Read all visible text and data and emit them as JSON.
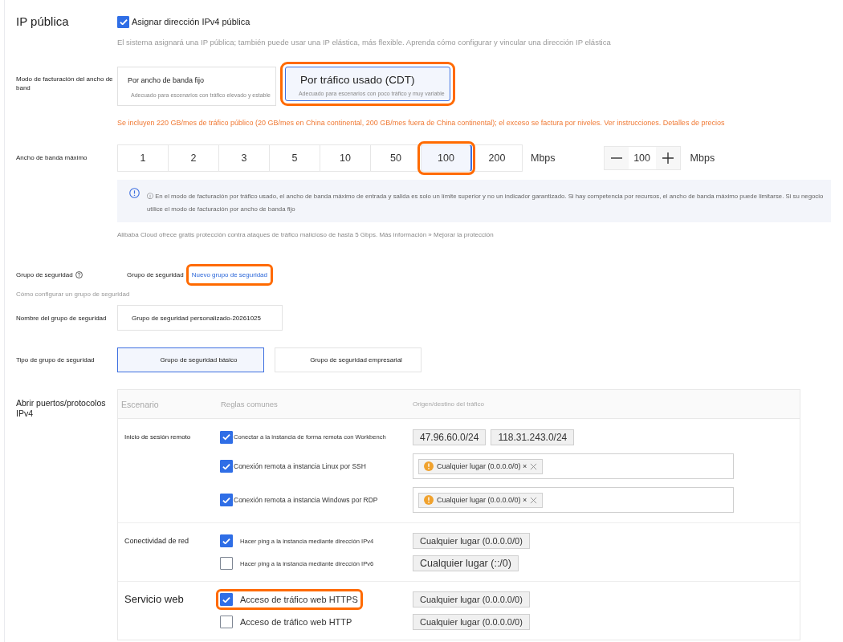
{
  "public_ip": {
    "label": "IP pública",
    "assign": {
      "label": "Asignar dirección IPv4 pública",
      "checked": true
    },
    "description": "El sistema asignará una IP pública; también puede usar una IP elástica, más flexible. Aprenda cómo configurar y vincular una dirección IP elástica"
  },
  "billing_mode": {
    "label": "Modo de facturación del ancho de band",
    "options": [
      {
        "title": "Por ancho de banda fijo",
        "description": "Adecuado para escenarios con tráfico elevado y estable",
        "selected": false,
        "highlighted": false
      },
      {
        "title": "Por tráfico usado (CDT)",
        "description": "Adecuado para escenarios con poco tráfico y muy variable",
        "selected": true,
        "highlighted": true
      }
    ],
    "note": "Se incluyen 220 GB/mes de tráfico público (20 GB/mes en China continental, 200 GB/mes fuera de China continental); el exceso se factura por niveles. Ver instrucciones. Detalles de precios"
  },
  "max_bandwidth": {
    "label": "Ancho de banda máximo",
    "options": [
      {
        "value": "1",
        "selected": false,
        "highlighted": false
      },
      {
        "value": "2",
        "selected": false,
        "highlighted": false
      },
      {
        "value": "3",
        "selected": false,
        "highlighted": false
      },
      {
        "value": "5",
        "selected": false,
        "highlighted": false
      },
      {
        "value": "10",
        "selected": false,
        "highlighted": false
      },
      {
        "value": "50",
        "selected": false,
        "highlighted": false
      },
      {
        "value": "100",
        "selected": true,
        "highlighted": true
      },
      {
        "value": "200",
        "selected": false,
        "highlighted": false
      }
    ],
    "unit": "Mbps",
    "stepper": {
      "value": "100",
      "unit": "Mbps"
    },
    "info_lines": [
      "ⓘ En el modo de facturación por tráfico usado, el ancho de banda máximo de entrada y salida es solo un límite superior y no un indicador garantizado. Si hay competencia por recursos, el ancho de banda máximo puede limitarse. Si su negocio",
      "utilice el modo de facturación por ancho de banda fijo"
    ],
    "protection_note": "Alibaba Cloud ofrece gratis protección contra ataques de tráfico malicioso de hasta 5 Gbps. Más información » Mejorar la protección"
  },
  "security_group": {
    "label": "Grupo de seguridad",
    "current": "Grupo de seguridad",
    "new_link": {
      "label": "Nuevo grupo de seguridad",
      "highlighted": true
    },
    "help_link": "Cómo configurar un grupo de seguridad"
  },
  "security_group_name": {
    "label": "Nombre del grupo de seguridad",
    "value": "Grupo de seguridad personalizado-20261025"
  },
  "security_group_type": {
    "label": "Tipo de grupo de seguridad",
    "options": [
      {
        "label": "Grupo de seguridad básico",
        "selected": true
      },
      {
        "label": "Grupo de seguridad empresarial",
        "selected": false
      }
    ]
  },
  "open_ports": {
    "label": "Abrir puertos/protocolos IPv4",
    "columns": [
      "Escenario",
      "Reglas comunes",
      "Origen/destino del tráfico"
    ],
    "groups": [
      {
        "scenario": "Inicio de sesión remoto",
        "rules": [
          {
            "label": "Conectar a la instancia de forma remota con Workbench",
            "checked": true,
            "highlighted": false,
            "source": {
              "kind": "tags",
              "tags": [
                "47.96.60.0/24",
                "118.31.243.0/24"
              ]
            }
          },
          {
            "label": "Conexión remota a instancia Linux por SSH",
            "checked": true,
            "highlighted": false,
            "source": {
              "kind": "field",
              "tags": [
                "Cualquier lugar (0.0.0.0/0) ×"
              ]
            }
          },
          {
            "label": "Conexión remota a instancia Windows por RDP",
            "checked": true,
            "highlighted": false,
            "source": {
              "kind": "field",
              "tags": [
                "Cualquier lugar (0.0.0.0/0) ×"
              ]
            }
          }
        ]
      },
      {
        "scenario": "Conectividad de red",
        "rules": [
          {
            "label": "Hacer ping a la instancia mediante dirección IPv4",
            "checked": true,
            "highlighted": false,
            "source": {
              "kind": "tags",
              "tags": [
                "Cualquier lugar (0.0.0.0/0)"
              ]
            }
          },
          {
            "label": "Hacer ping a la instancia mediante dirección IPv6",
            "checked": false,
            "highlighted": false,
            "source": {
              "kind": "tags",
              "tags": [
                "Cualquier lugar (::/0)"
              ]
            }
          }
        ]
      },
      {
        "scenario": "Servicio web",
        "rules": [
          {
            "label": "Acceso de tráfico web HTTPS",
            "checked": true,
            "highlighted": true,
            "source": {
              "kind": "tags",
              "tags": [
                "Cualquier lugar (0.0.0.0/0)"
              ]
            }
          },
          {
            "label": "Acceso de tráfico web HTTP",
            "checked": false,
            "highlighted": false,
            "source": {
              "kind": "tags",
              "tags": [
                "Cualquier lugar (0.0.0.0/0)"
              ]
            }
          }
        ]
      }
    ]
  }
}
